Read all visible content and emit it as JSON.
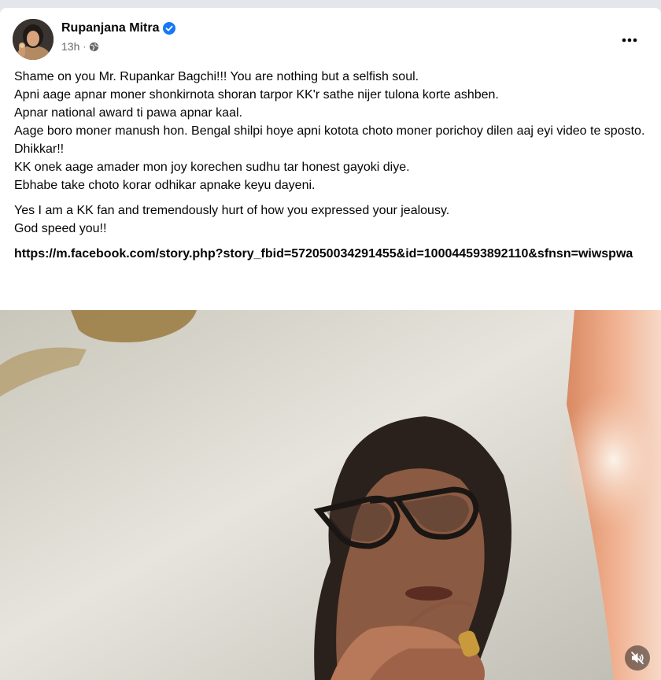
{
  "post": {
    "author": "Rupanjana Mitra",
    "timestamp": "13h",
    "audience_icon": "globe-icon",
    "verified_icon": "verified-badge-icon",
    "more_icon": "more-options-icon",
    "paragraphs": [
      [
        "Shame on you Mr. Rupankar Bagchi!!! You are nothing but a selfish soul.",
        "Apni aage apnar moner shonkirnota shoran tarpor KK'r  sathe nijer tulona korte ashben.",
        "Apnar national award ti pawa apnar kaal.",
        "Aage boro moner manush hon. Bengal shilpi hoye apni kotota choto moner porichoy dilen aaj eyi video te sposto.",
        "Dhikkar!!",
        "KK onek aage amader mon joy korechen sudhu tar honest gayoki diye.",
        "Ebhabe take choto korar odhikar apnake keyu dayeni."
      ],
      [
        "Yes I am a KK fan and tremendously hurt of how you expressed your jealousy.",
        "God speed you!!"
      ]
    ],
    "link": "https://m.facebook.com/story.php?story_fbid=572050034291455&id=100044593892110&sfnsn=wiwspwa"
  },
  "video": {
    "mute_icon": "speaker-muted-icon"
  },
  "colors": {
    "page_bg": "#e4e6eb",
    "card_bg": "#ffffff",
    "secondary_text": "#65676b",
    "verified_blue": "#1877f2"
  }
}
